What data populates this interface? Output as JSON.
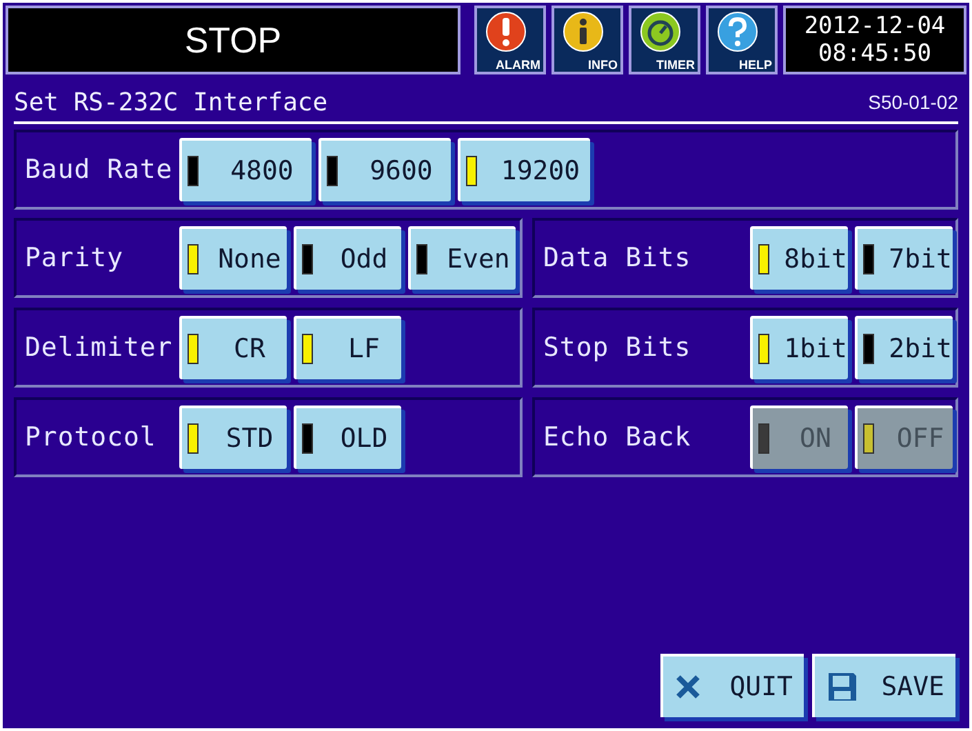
{
  "status": "STOP",
  "header_buttons": [
    {
      "kind": "alarm",
      "label": "ALARM"
    },
    {
      "kind": "info",
      "label": "INFO"
    },
    {
      "kind": "timer",
      "label": "TIMER"
    },
    {
      "kind": "help",
      "label": "HELP"
    }
  ],
  "clock": {
    "date": "2012-12-04",
    "time": "08:45:50"
  },
  "title": {
    "text": "Set RS-232C Interface",
    "code": "S50-01-02"
  },
  "baud_rate": {
    "label": "Baud Rate",
    "disabled": false,
    "options": [
      {
        "label": "4800",
        "selected": false
      },
      {
        "label": "9600",
        "selected": false
      },
      {
        "label": "19200",
        "selected": true
      }
    ]
  },
  "left_groups": [
    {
      "label": "Parity",
      "disabled": false,
      "options": [
        {
          "label": "None",
          "selected": true
        },
        {
          "label": "Odd",
          "selected": false
        },
        {
          "label": "Even",
          "selected": false
        }
      ]
    },
    {
      "label": "Delimiter",
      "disabled": false,
      "options": [
        {
          "label": "CR",
          "selected": true
        },
        {
          "label": "LF",
          "selected": true
        }
      ]
    },
    {
      "label": "Protocol",
      "disabled": false,
      "options": [
        {
          "label": "STD",
          "selected": true
        },
        {
          "label": "OLD",
          "selected": false
        }
      ]
    }
  ],
  "right_groups": [
    {
      "label": "Data Bits",
      "disabled": false,
      "options": [
        {
          "label": "8bit",
          "selected": true
        },
        {
          "label": "7bit",
          "selected": false
        }
      ]
    },
    {
      "label": "Stop Bits",
      "disabled": false,
      "options": [
        {
          "label": "1bit",
          "selected": true
        },
        {
          "label": "2bit",
          "selected": false
        }
      ]
    },
    {
      "label": "Echo Back",
      "disabled": true,
      "options": [
        {
          "label": "ON",
          "selected": false
        },
        {
          "label": "OFF",
          "selected": true
        }
      ]
    }
  ],
  "footer_buttons": [
    {
      "kind": "quit",
      "label": "QUIT"
    },
    {
      "kind": "save",
      "label": "SAVE"
    }
  ]
}
